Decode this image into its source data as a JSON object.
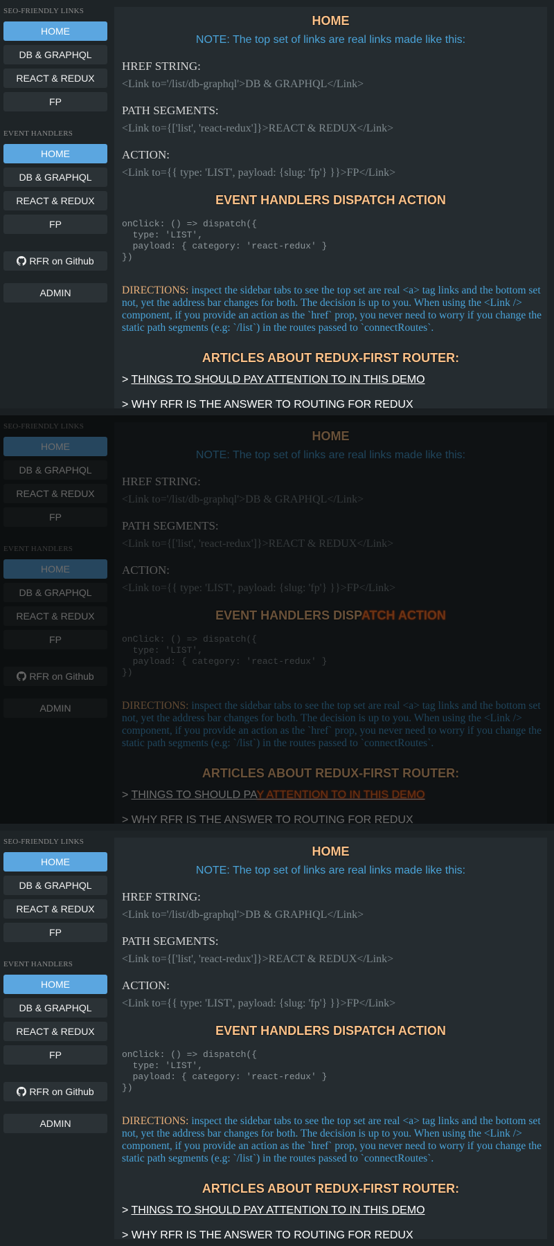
{
  "sidebar": {
    "seo_title": "SEO-FRIENDLY LINKS",
    "seo_links": [
      "HOME",
      "DB & GRAPHQL",
      "REACT & REDUX",
      "FP"
    ],
    "event_title": "EVENT HANDLERS",
    "event_links": [
      "HOME",
      "DB & GRAPHQL",
      "REACT & REDUX",
      "FP"
    ],
    "github_label": "RFR on Github",
    "admin_label": "ADMIN"
  },
  "main": {
    "title": "HOME",
    "note": "NOTE: The top set of links are real links made like this:",
    "href_label": "HREF STRING:",
    "href_code": "<Link to='/list/db-graphql'>DB & GRAPHQL</Link>",
    "path_label": "PATH SEGMENTS:",
    "path_code": "<Link to={['list', 'react-redux']}>REACT & REDUX</Link>",
    "action_label": "ACTION:",
    "action_code": "<Link to={{ type: 'LIST', payload: {slug: 'fp'} }}>FP</Link>",
    "dispatch_title": "EVENT HANDLERS DISPATCH ACTION",
    "dispatch_code": "onClick: () => dispatch({\n  type: 'LIST',\n  payload: { category: 'react-redux' }\n})",
    "directions_label": "DIRECTIONS:",
    "directions_text": " inspect the sidebar tabs to see the top set are real <a> tag links and the bottom set not, yet the address bar changes for both. The decision is up to you. When using the <Link /> component, if you provide an action as the `href` prop, you never need to worry if you change the static path segments (e.g: `/list`) in the routes passed to `connectRoutes`.",
    "articles_title": "ARTICLES ABOUT REDUX-FIRST ROUTER:",
    "article1_prefix": "> ",
    "article1": "THINGS TO SHOULD PAY ATTENTION TO IN THIS DEMO",
    "article2": "> WHY RFR IS THE ANSWER TO ROUTING FOR REDUX"
  },
  "panel2_highlight": {
    "dispatch_prefix": "EVENT HANDLERS DISP",
    "dispatch_hl": "ATCH ACTION",
    "article_prefix": "THINGS TO SHOULD PA",
    "article_hl": "Y ATTENTION TO IN THIS DEMO"
  },
  "colors": {
    "background": "#1e2427",
    "content_bg": "#252c30",
    "active_button": "#5ba6e0",
    "heading_orange": "#fbc189",
    "note_blue": "#4aa3d8",
    "highlight": "#ff7a2e"
  },
  "icons": {
    "github": "github-icon"
  }
}
